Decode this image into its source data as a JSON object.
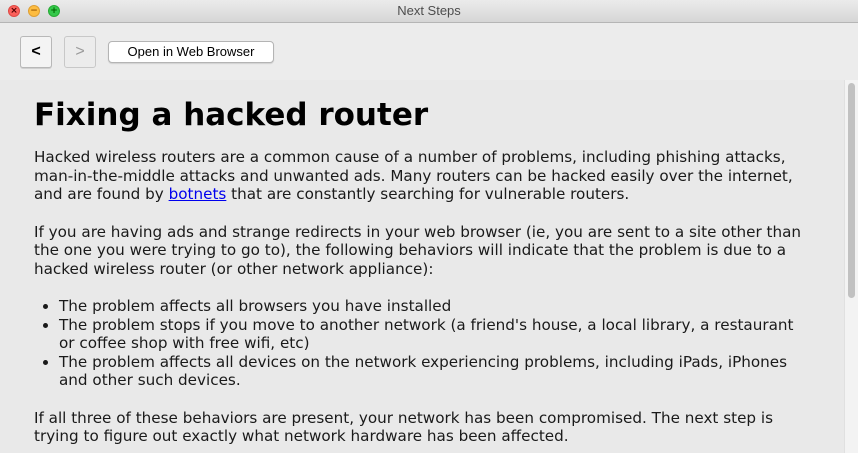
{
  "window": {
    "title": "Next Steps",
    "close_glyph": "×",
    "minimize_glyph": "−",
    "maximize_glyph": "+"
  },
  "toolbar": {
    "back_label": "<",
    "forward_label": ">",
    "open_browser_label": "Open in Web Browser"
  },
  "article": {
    "heading": "Fixing a hacked router",
    "p1_before": "Hacked wireless routers are a common cause of a number of problems, including phishing attacks, man-in-the-middle attacks and unwanted ads. Many routers can be hacked easily over the internet, and are found by ",
    "p1_link": "botnets",
    "p1_after": " that are constantly searching for vulnerable routers.",
    "p2": "If you are having ads and strange redirects in your web browser (ie, you are sent to a site other than the one you were trying to go to), the following behaviors will indicate that the problem is due to a hacked wireless router (or other network appliance):",
    "bullets": [
      "The problem affects all browsers you have installed",
      "The problem stops if you move to another network (a friend's house, a local library, a restaurant or coffee shop with free wifi, etc)",
      "The problem affects all devices on the network experiencing problems, including iPads, iPhones and other such devices."
    ],
    "p3": "If all three of these behaviors are present, your network has been compromised. The next step is trying to figure out exactly what network hardware has been affected."
  },
  "colors": {
    "link": "#0000ee",
    "close": "#fc605b",
    "minimize": "#fdbc40",
    "maximize": "#34c84a"
  }
}
